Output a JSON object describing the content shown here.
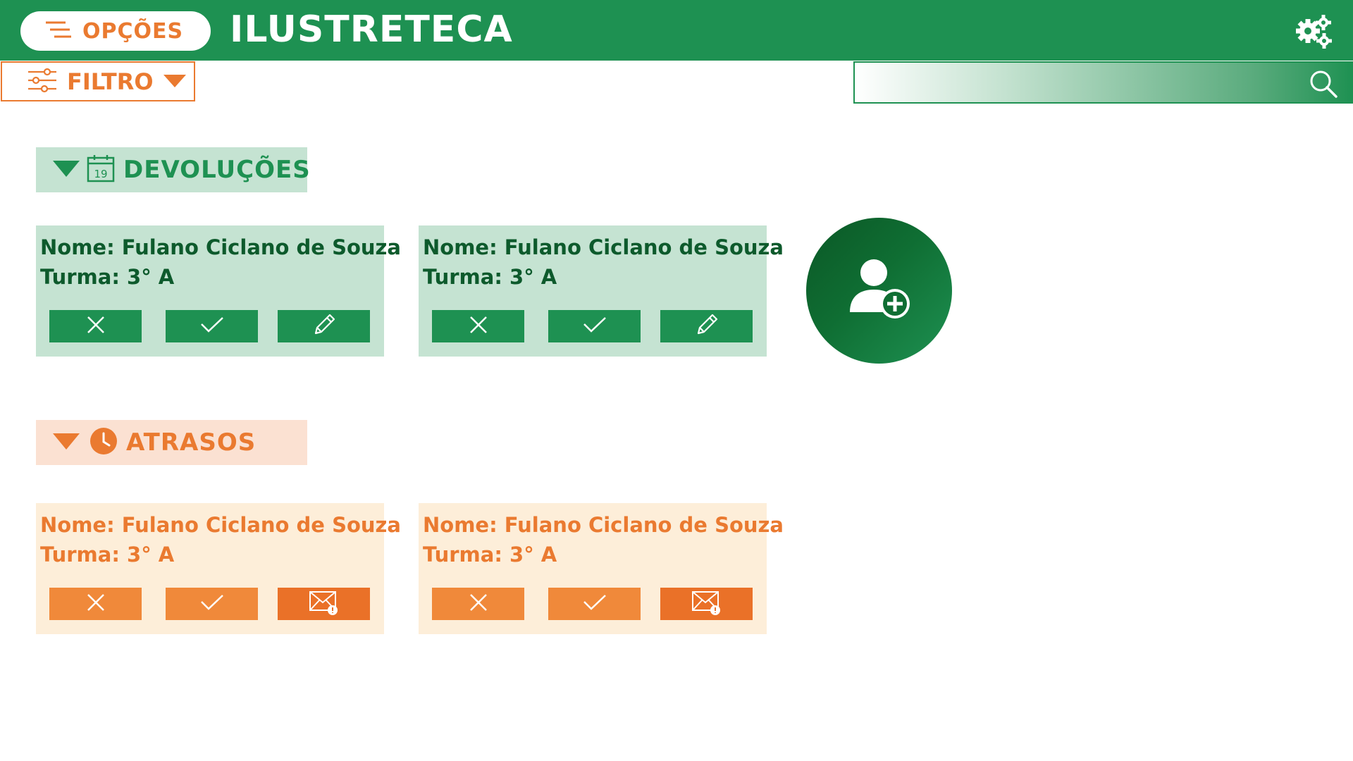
{
  "header": {
    "options_label": "OPÇÕES",
    "app_title": "ILUSTRETECA"
  },
  "toolbar": {
    "filter_label": "FILTRO",
    "search_placeholder": ""
  },
  "sections": {
    "returns": {
      "title": "DEVOLUÇÕES",
      "calendar_day": "19",
      "color": "#1e9152",
      "cards": [
        {
          "name": "Nome: Fulano Ciclano de Souza",
          "class": "Turma: 3° A"
        },
        {
          "name": "Nome: Fulano Ciclano de Souza",
          "class": "Turma: 3° A"
        }
      ],
      "actions": [
        "close-icon",
        "check-icon",
        "pencil-icon"
      ]
    },
    "late": {
      "title": "ATRASOS",
      "color": "#ea7a30",
      "cards": [
        {
          "name": "Nome: Fulano Ciclano de Souza",
          "class": "Turma: 3° A"
        },
        {
          "name": "Nome: Fulano Ciclano de Souza",
          "class": "Turma: 3° A"
        }
      ],
      "actions": [
        "close-icon",
        "check-icon",
        "mail-alert-icon"
      ]
    }
  },
  "fab": {
    "icon": "add-user-icon"
  }
}
